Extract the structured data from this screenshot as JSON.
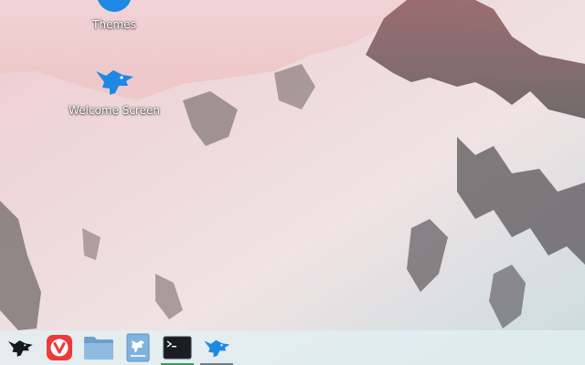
{
  "desktop": {
    "icons": [
      {
        "label": "Themes",
        "icon": "themes-icon"
      },
      {
        "label": "Welcome Screen",
        "icon": "bird-icon"
      }
    ]
  },
  "taskbar": {
    "items": [
      {
        "name": "start-menu",
        "icon": "bird-icon",
        "running": false
      },
      {
        "name": "vivaldi-browser",
        "icon": "vivaldi-icon",
        "running": false
      },
      {
        "name": "file-manager",
        "icon": "folder-icon",
        "running": false
      },
      {
        "name": "document-viewer",
        "icon": "document-icon",
        "running": false
      },
      {
        "name": "terminal",
        "icon": "terminal-icon",
        "running": true
      },
      {
        "name": "welcome-screen",
        "icon": "bird-icon",
        "running": true
      }
    ]
  },
  "colors": {
    "accent": "#1e88e5",
    "vivaldi": "#ef3939",
    "folder": "#8ab4d8",
    "terminal": "#1a1d22"
  }
}
